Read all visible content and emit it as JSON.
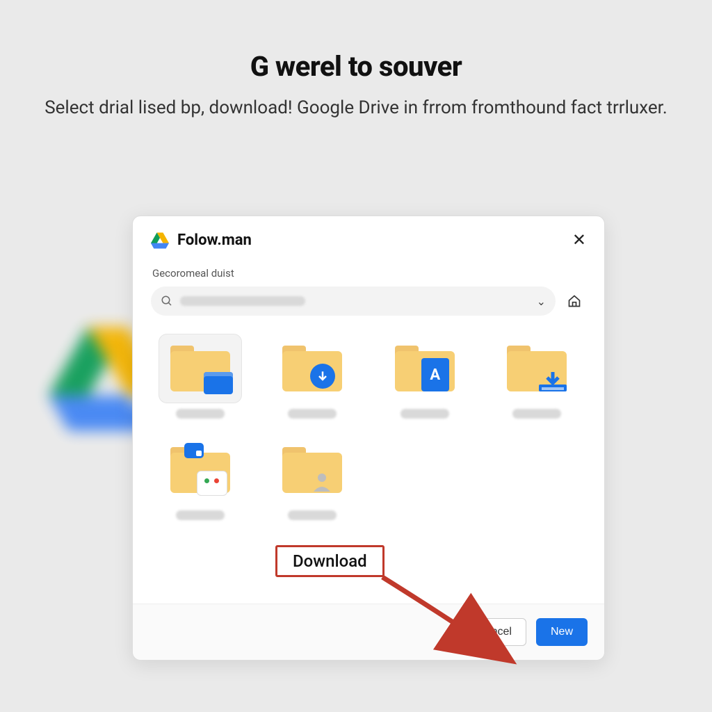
{
  "hero": {
    "title": "G werel to souver",
    "subtitle": "Select drial lised bp, download! Google Drive in frrom fromthound fact trrluxer."
  },
  "dialog": {
    "title": "Folow.man",
    "section_label": "Gecoromeal duist",
    "search_placeholder": "",
    "folders": [
      {
        "id": "f1",
        "variant": "blue-doc",
        "selected": true
      },
      {
        "id": "f2",
        "variant": "dl-circle",
        "selected": false
      },
      {
        "id": "f3",
        "variant": "a-doc",
        "selected": false
      },
      {
        "id": "f4",
        "variant": "tray",
        "selected": false
      },
      {
        "id": "f5",
        "variant": "card-chip",
        "selected": false
      },
      {
        "id": "f6",
        "variant": "person",
        "selected": false
      }
    ],
    "callout_label": "Download",
    "footer": {
      "cancel": "Cancel",
      "confirm": "New"
    }
  },
  "icons": {
    "a_letter": "A"
  }
}
